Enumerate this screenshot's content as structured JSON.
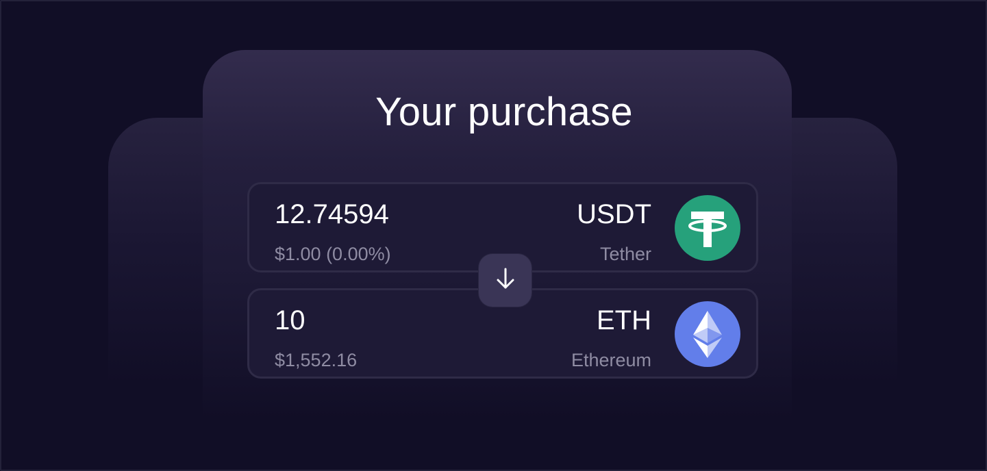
{
  "title": "Your purchase",
  "from": {
    "amount": "12.74594",
    "fiat": "$1.00 (0.00%)",
    "symbol": "USDT",
    "name": "Tether",
    "icon": "tether-icon",
    "color": "#26a17b"
  },
  "to": {
    "amount": "10",
    "fiat": "$1,552.16",
    "symbol": "ETH",
    "name": "Ethereum",
    "icon": "ethereum-icon",
    "color": "#627eea"
  },
  "swap_icon": "arrow-down-icon",
  "colors": {
    "background": "#110e26",
    "card": "#241f3d",
    "row": "#1e1a36",
    "swap_button": "#3a3556",
    "secondary_text": "#8f8ca3"
  }
}
